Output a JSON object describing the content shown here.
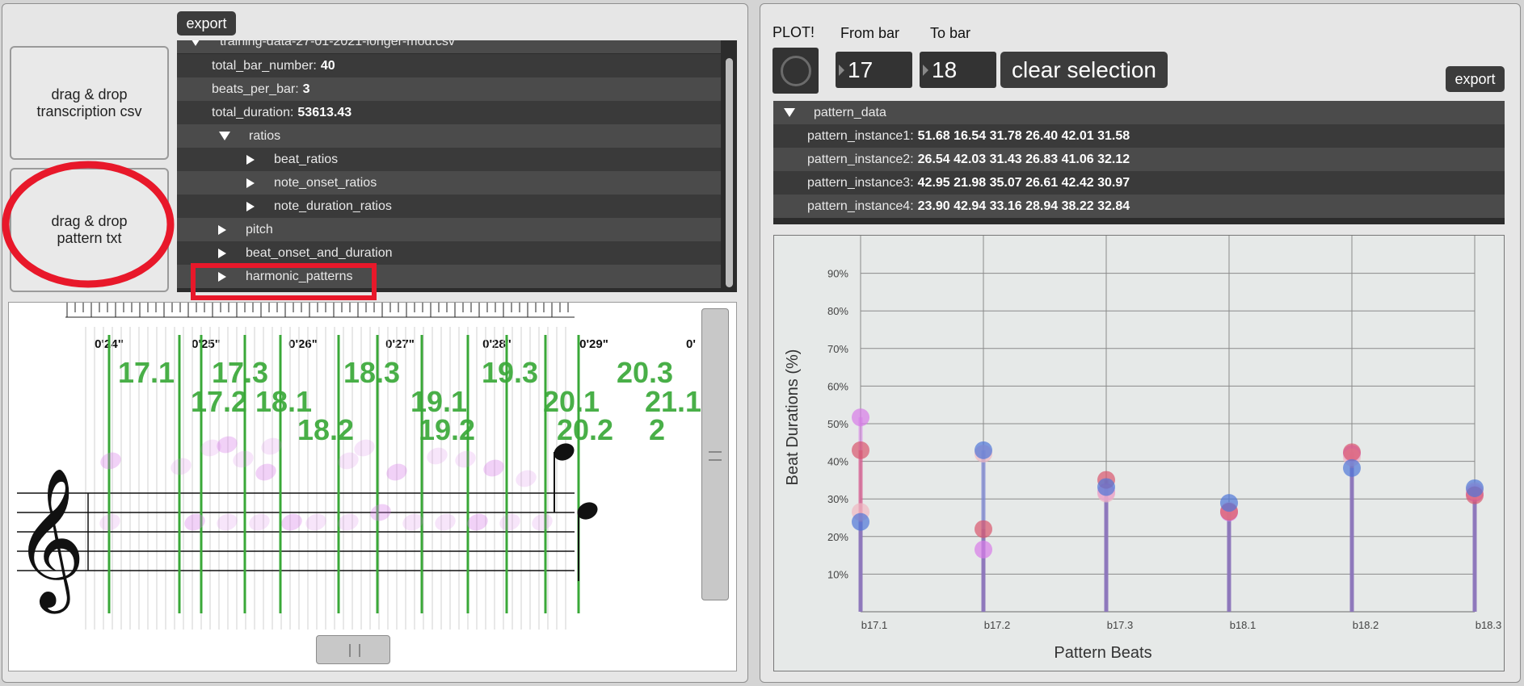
{
  "left": {
    "export_label": "export",
    "dropzone_csv": "drag & drop\ntranscription csv",
    "dropzone_txt": "drag & drop\npattern txt",
    "tree": {
      "file_name": "training-data-27-01-2021-longer-mod.csv",
      "rows": [
        {
          "key": "total_bar_number:",
          "value": "40"
        },
        {
          "key": "beats_per_bar:",
          "value": "3"
        },
        {
          "key": "total_duration:",
          "value": "53613.43"
        },
        {
          "label": "ratios"
        },
        {
          "label": "beat_ratios"
        },
        {
          "label": "note_onset_ratios"
        },
        {
          "label": "note_duration_ratios"
        },
        {
          "label": "pitch"
        },
        {
          "label": "beat_onset_and_duration"
        },
        {
          "label": "harmonic_patterns"
        }
      ]
    },
    "score": {
      "time_labels": [
        "0'24\"",
        "0'25\"",
        "0'26\"",
        "0'27\"",
        "0'28\"",
        "0'29\"",
        "0'"
      ],
      "beat_labels": [
        "17.1",
        "17.3",
        "17.2",
        "18.1",
        "18.3",
        "18.2",
        "19.1",
        "19.3",
        "19.2",
        "20.1",
        "20.3",
        "20.2",
        "21.1",
        "2"
      ]
    }
  },
  "right": {
    "plot_label": "PLOT!",
    "from_bar_label": "From bar",
    "to_bar_label": "To bar",
    "from_bar_value": "17",
    "to_bar_value": "18",
    "clear_label": "clear selection",
    "export_label": "export",
    "pattern_tree": {
      "title": "pattern_data",
      "rows": [
        {
          "key": "pattern_instance1:",
          "value": "51.68 16.54 31.78 26.40 42.01 31.58"
        },
        {
          "key": "pattern_instance2:",
          "value": "26.54 42.03 31.43 26.83 41.06 32.12"
        },
        {
          "key": "pattern_instance3:",
          "value": "42.95 21.98 35.07 26.61 42.42 30.97"
        },
        {
          "key": "pattern_instance4:",
          "value": "23.90 42.94 33.16 28.94 38.22 32.84"
        }
      ]
    }
  },
  "colors": {
    "instance1": "#d77be8",
    "instance2": "#f0b7c2",
    "instance3": "#d9566e",
    "instance4": "#4f76d9",
    "stem": "#7b5cc4",
    "annotation_red": "#e8182a",
    "beat_green": "#3aa838"
  },
  "chart_data": {
    "type": "scatter",
    "xlabel": "Pattern Beats",
    "ylabel": "Beat Durations (%)",
    "categories": [
      "b17.1",
      "b17.2",
      "b17.3",
      "b18.1",
      "b18.2",
      "b18.3"
    ],
    "y_ticks": [
      "10%",
      "20%",
      "30%",
      "40%",
      "50%",
      "60%",
      "70%",
      "80%",
      "90%"
    ],
    "ylim": [
      0,
      100
    ],
    "grid": true,
    "series": [
      {
        "values": [
          51.68,
          16.54,
          31.78,
          26.4,
          42.01,
          31.58
        ]
      },
      {
        "values": [
          26.54,
          42.03,
          31.43,
          26.83,
          41.06,
          32.12
        ]
      },
      {
        "values": [
          42.95,
          21.98,
          35.07,
          26.61,
          42.42,
          30.97
        ]
      },
      {
        "values": [
          23.9,
          42.94,
          33.16,
          28.94,
          38.22,
          32.84
        ]
      }
    ]
  }
}
